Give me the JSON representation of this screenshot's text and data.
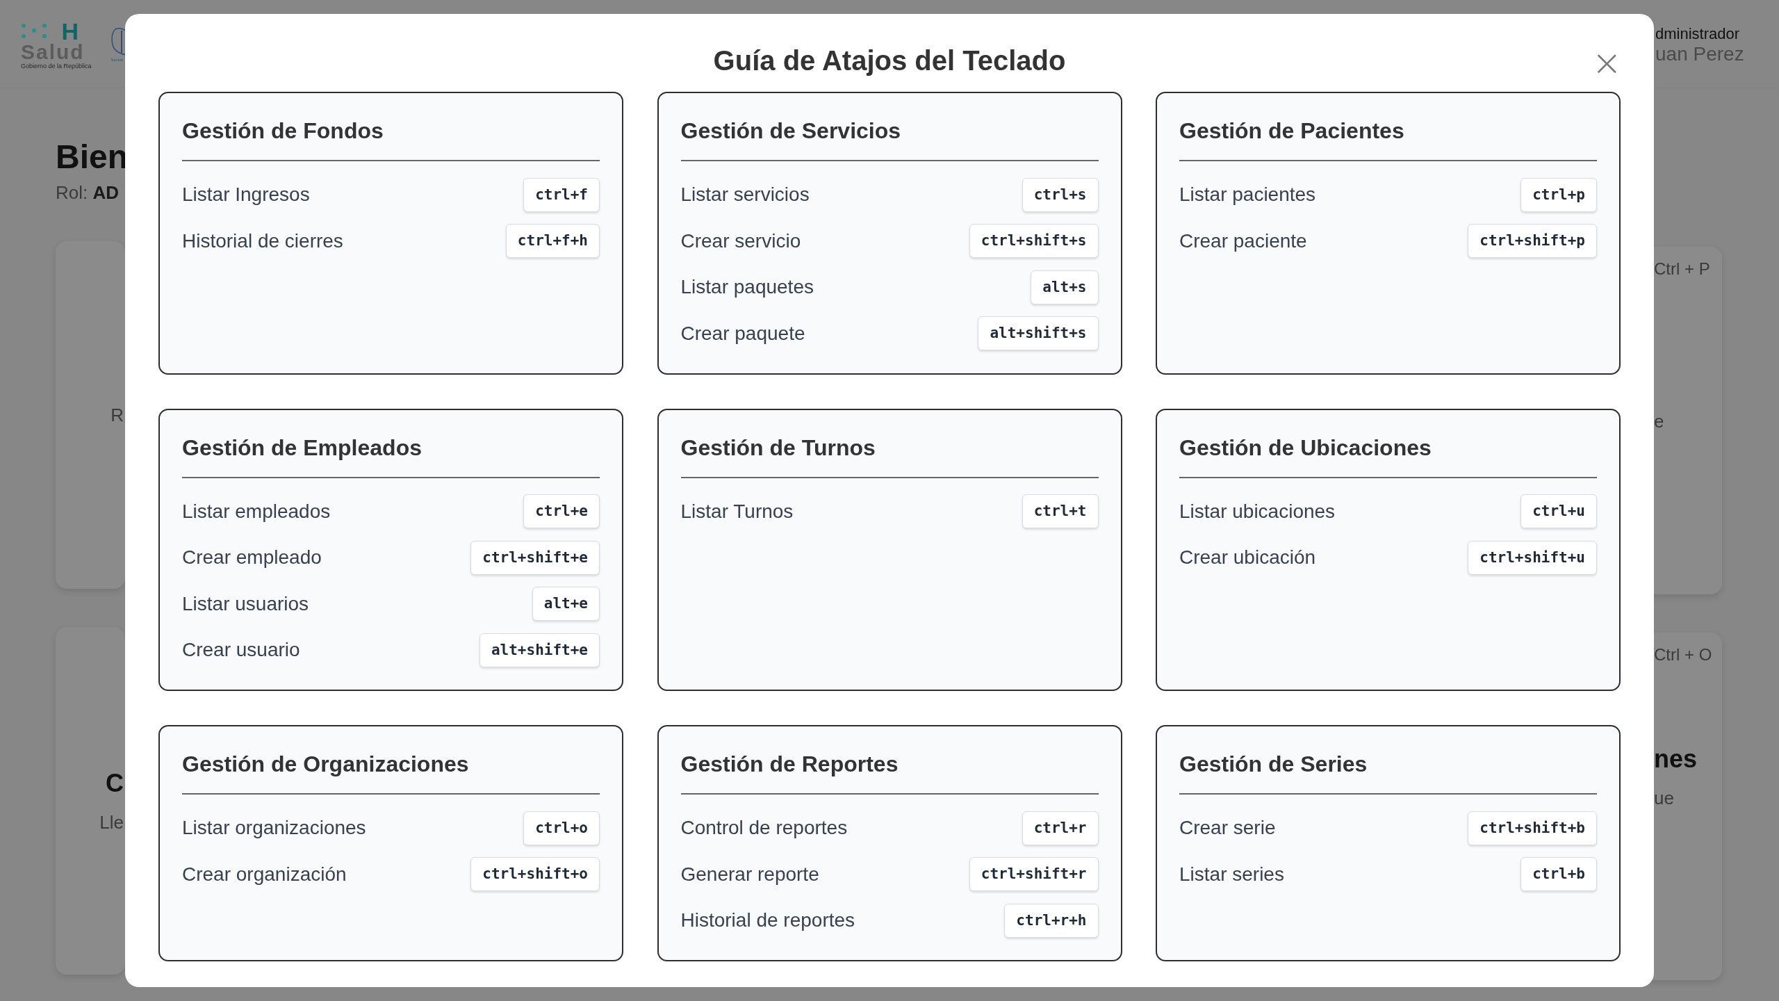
{
  "background": {
    "logo": {
      "mark": "H",
      "name": "Salud",
      "subtitle": "Gobierno de la República"
    },
    "emblem_caption": "Secret",
    "user": {
      "role": "dministrador",
      "name": "uan Perez"
    },
    "heading": "Bien",
    "role_label": "Rol:",
    "role_value": "AD",
    "left_cards": [
      {
        "text": "R"
      },
      {
        "title": "C",
        "text": "Lle"
      }
    ],
    "right_cards": [
      {
        "shortcut": "Ctrl + P",
        "text": "e"
      },
      {
        "shortcut": "Ctrl + O",
        "title": "nes",
        "text": "ue"
      }
    ]
  },
  "dialog": {
    "title": "Guía de Atajos del Teclado",
    "close": "×",
    "sections": [
      {
        "title": "Gestión de Fondos",
        "shortcuts": [
          {
            "label": "Listar Ingresos",
            "keys": "ctrl+f"
          },
          {
            "label": "Historial de cierres",
            "keys": "ctrl+f+h"
          }
        ]
      },
      {
        "title": "Gestión de Servicios",
        "shortcuts": [
          {
            "label": "Listar servicios",
            "keys": "ctrl+s"
          },
          {
            "label": "Crear servicio",
            "keys": "ctrl+shift+s"
          },
          {
            "label": "Listar paquetes",
            "keys": "alt+s"
          },
          {
            "label": "Crear paquete",
            "keys": "alt+shift+s"
          }
        ]
      },
      {
        "title": "Gestión de Pacientes",
        "shortcuts": [
          {
            "label": "Listar pacientes",
            "keys": "ctrl+p"
          },
          {
            "label": "Crear paciente",
            "keys": "ctrl+shift+p"
          }
        ]
      },
      {
        "title": "Gestión de Empleados",
        "shortcuts": [
          {
            "label": "Listar empleados",
            "keys": "ctrl+e"
          },
          {
            "label": "Crear empleado",
            "keys": "ctrl+shift+e"
          },
          {
            "label": "Listar usuarios",
            "keys": "alt+e"
          },
          {
            "label": "Crear usuario",
            "keys": "alt+shift+e"
          }
        ]
      },
      {
        "title": "Gestión de Turnos",
        "shortcuts": [
          {
            "label": "Listar Turnos",
            "keys": "ctrl+t"
          }
        ]
      },
      {
        "title": "Gestión de Ubicaciones",
        "shortcuts": [
          {
            "label": "Listar ubicaciones",
            "keys": "ctrl+u"
          },
          {
            "label": "Crear ubicación",
            "keys": "ctrl+shift+u"
          }
        ]
      },
      {
        "title": "Gestión de Organizaciones",
        "shortcuts": [
          {
            "label": "Listar organizaciones",
            "keys": "ctrl+o"
          },
          {
            "label": "Crear organización",
            "keys": "ctrl+shift+o"
          }
        ]
      },
      {
        "title": "Gestión de Reportes",
        "shortcuts": [
          {
            "label": "Control de reportes",
            "keys": "ctrl+r"
          },
          {
            "label": "Generar reporte",
            "keys": "ctrl+shift+r"
          },
          {
            "label": "Historial de reportes",
            "keys": "ctrl+r+h"
          }
        ]
      },
      {
        "title": "Gestión de Series",
        "shortcuts": [
          {
            "label": "Crear serie",
            "keys": "ctrl+shift+b"
          },
          {
            "label": "Listar series",
            "keys": "ctrl+b"
          }
        ]
      }
    ]
  }
}
